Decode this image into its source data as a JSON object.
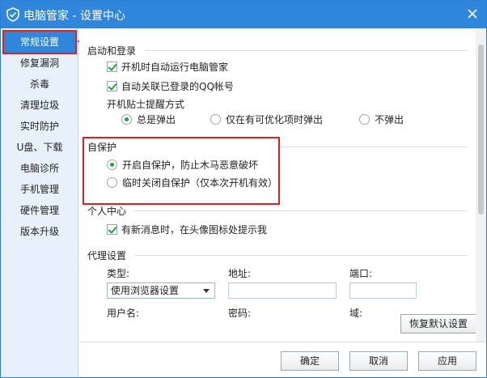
{
  "window": {
    "title": "电脑管家 - 设置中心"
  },
  "sidebar": {
    "items": [
      {
        "label": "常规设置",
        "active": true
      },
      {
        "label": "修复漏洞"
      },
      {
        "label": "杀毒"
      },
      {
        "label": "清理垃圾"
      },
      {
        "label": "实时防护"
      },
      {
        "label": "U盘、下载"
      },
      {
        "label": "电脑诊所"
      },
      {
        "label": "手机管理"
      },
      {
        "label": "硬件管理"
      },
      {
        "label": "版本升级"
      }
    ]
  },
  "startup": {
    "title": "启动和登录",
    "auto_run": {
      "label": "开机时自动运行电脑管家",
      "checked": true
    },
    "auto_link_qq": {
      "label": "自动关联已登录的QQ帐号",
      "checked": true
    },
    "tip_mode_label": "开机贴士提醒方式",
    "tip_options": [
      {
        "label": "总是弹出",
        "checked": true
      },
      {
        "label": "仅在有可优化项时弹出",
        "checked": false
      },
      {
        "label": "不弹出",
        "checked": false
      }
    ]
  },
  "self_protect": {
    "title": "自保护",
    "options": [
      {
        "label": "开启自保护，防止木马恶意破坏",
        "checked": true
      },
      {
        "label": "临时关闭自保护（仅本次开机有效）",
        "checked": false
      }
    ]
  },
  "personal": {
    "title": "个人中心",
    "notify": {
      "label": "有新消息时，在头像图标处提示我",
      "checked": true
    }
  },
  "proxy": {
    "title": "代理设置",
    "type_label": "类型:",
    "type_value": "使用浏览器设置",
    "address_label": "地址:",
    "port_label": "端口:",
    "user_label_cut": "用户名:",
    "password_label_cut": "密码:",
    "domain_label_cut": "域:"
  },
  "buttons": {
    "restore_default": "恢复默认设置",
    "ok": "确定",
    "cancel": "取消",
    "apply": "应用"
  },
  "colors": {
    "accent": "#2f86da",
    "annotation": "#e02020",
    "check": "#2c9b3a"
  }
}
